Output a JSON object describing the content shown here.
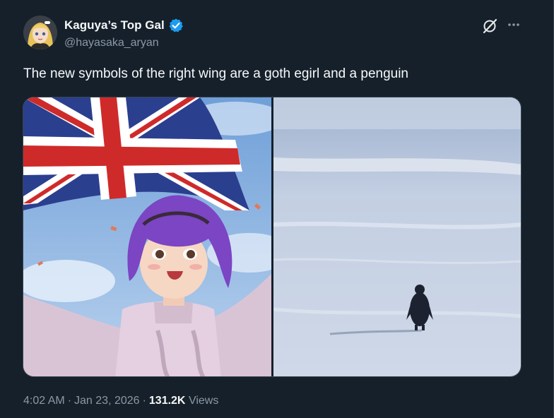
{
  "author": {
    "display_name": "Kaguya’s Top Gal",
    "handle": "@hayasaka_aryan",
    "verified": true
  },
  "icons": {
    "verified": "verified-badge-icon",
    "grok": "grok-icon",
    "more": "more-options-icon"
  },
  "tweet": {
    "text": "The new symbols of the right wing are a goth egirl and a penguin"
  },
  "media": [
    {
      "kind": "image",
      "subject": "anime-girl-union-jack"
    },
    {
      "kind": "image",
      "subject": "penguin-on-ice"
    }
  ],
  "meta": {
    "time": "4:02 AM",
    "separator": "·",
    "date": "Jan 23, 2026",
    "views_count": "131.2K",
    "views_label": "Views"
  },
  "colors": {
    "background": "#15202b",
    "text": "#f7f9f9",
    "muted": "#8b98a5",
    "verified": "#1d9bf0"
  }
}
